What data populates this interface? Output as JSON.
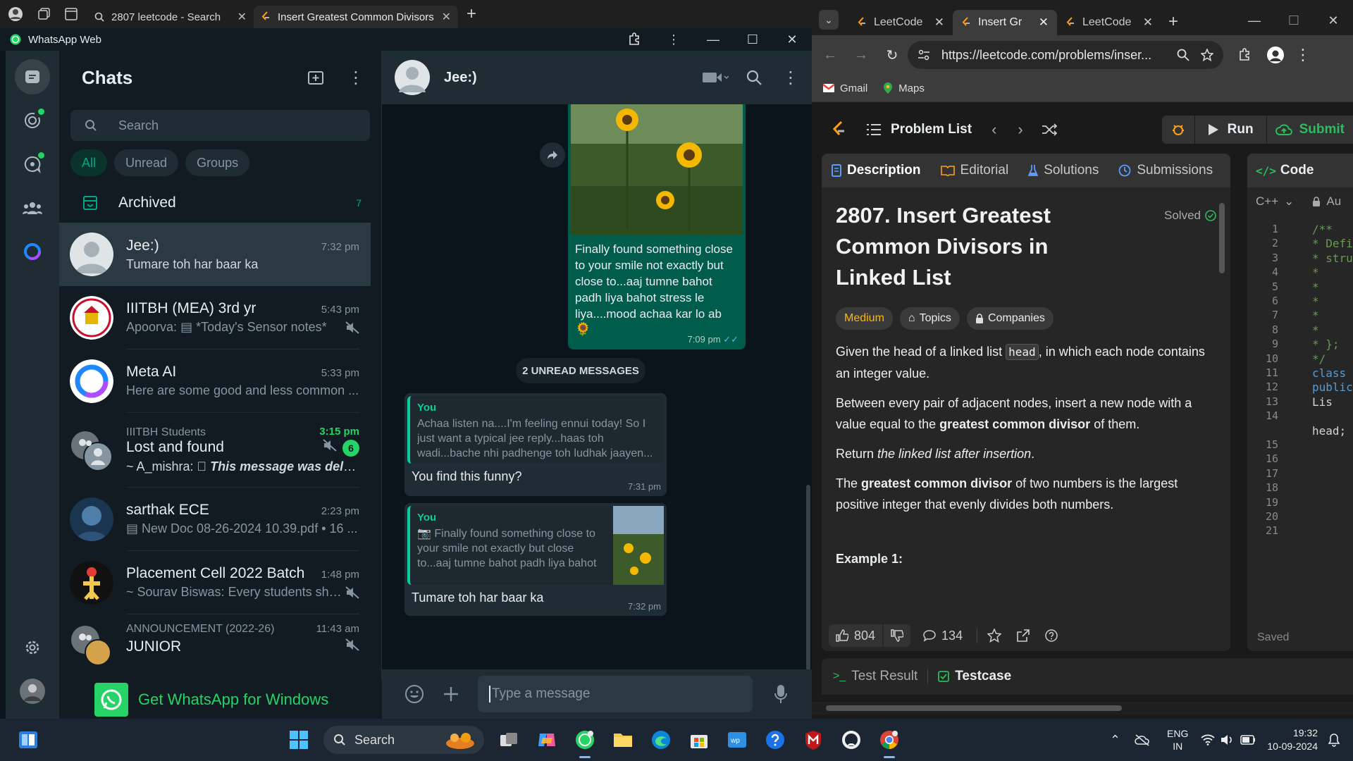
{
  "left_browser": {
    "tabs": [
      {
        "title": "2807 leetcode - Search"
      },
      {
        "title": "Insert Greatest Common Divisors"
      }
    ],
    "app_title": "WhatsApp Web"
  },
  "chats_panel": {
    "title": "Chats",
    "search_placeholder": "Search",
    "filters": [
      "All",
      "Unread",
      "Groups"
    ],
    "archived": {
      "label": "Archived",
      "count": "7"
    },
    "items": [
      {
        "name": "Jee:)",
        "time": "7:32 pm",
        "preview": "Tumare toh har baar ka"
      },
      {
        "name": "IIITBH (MEA)  3rd yr",
        "time": "5:43 pm",
        "sender": "Apoorva:",
        "preview": "*Today's Sensor notes*"
      },
      {
        "name": "Meta AI",
        "time": "5:33 pm",
        "preview": "Here are some good and less common ..."
      },
      {
        "group_label": "IIITBH Students",
        "name": "Lost and found",
        "time": "3:15 pm",
        "unread": "6",
        "sender": "~ A_mishra:",
        "preview": "This message was deleted"
      },
      {
        "name": "sarthak ECE",
        "time": "2:23 pm",
        "preview": "New Doc 08-26-2024 10.39.pdf • 16 ..."
      },
      {
        "name": "Placement Cell 2022 Batch",
        "time": "1:48 pm",
        "preview": "~ Sourav Biswas: Every students shou..."
      },
      {
        "group_label": "ANNOUNCEMENT (2022-26)",
        "name": "JUNIOR",
        "time": "11:43 am"
      }
    ],
    "get_app": "Get WhatsApp for Windows"
  },
  "conversation": {
    "contact": "Jee:)",
    "messages": [
      {
        "type": "out_image",
        "text": "Finally found something close to your smile not exactly but close to...aaj tumne bahot padh liya bahot stress le liya....mood achaa kar lo ab",
        "emoji": "🌻",
        "time": "7:09 pm"
      },
      {
        "type": "divider",
        "text": "2 UNREAD MESSAGES"
      },
      {
        "type": "in_reply",
        "quote_author": "You",
        "quote_text": "Achaa listen na....I'm feeling ennui today! So I just want a typical jee reply...haas toh wadi...bache nhi padhenge toh ludhak jaayen...",
        "text": "You find this funny?",
        "time": "7:31 pm"
      },
      {
        "type": "in_reply",
        "quote_author": "You",
        "quote_text": "Finally found something close to your smile not exactly but close to...aaj tumne bahot padh liya bahot stress le liya....mood achaa kar lo ab...",
        "text": "Tumare toh har baar ka",
        "time": "7:32 pm"
      }
    ],
    "composer_placeholder": "Type a message"
  },
  "right_browser": {
    "tabs": [
      {
        "title": "LeetCode"
      },
      {
        "title": "Insert Gr"
      },
      {
        "title": "LeetCode"
      }
    ],
    "url": "https://leetcode.com/problems/inser...",
    "bookmarks": [
      "Gmail",
      "Maps"
    ],
    "nav": {
      "problem_list": "Problem List",
      "run": "Run",
      "submit": "Submit"
    },
    "desc_tabs": [
      "Description",
      "Editorial",
      "Solutions",
      "Submissions"
    ],
    "problem": {
      "title": "2807. Insert Greatest Common Divisors in Linked List",
      "status": "Solved",
      "difficulty": "Medium",
      "tags": [
        "Topics",
        "Companies"
      ],
      "p1_a": "Given the head of a linked list ",
      "p1_code": "head",
      "p1_b": ", in which each node contains an integer value.",
      "p2_a": "Between every pair of adjacent nodes, insert a new node with a value equal to the ",
      "p2_bold": "greatest common divisor",
      "p2_b": " of them.",
      "p3_a": "Return ",
      "p3_em": "the linked list after insertion",
      "p3_b": ".",
      "p4_a": "The ",
      "p4_bold": "greatest common divisor",
      "p4_b": " of two numbers is the largest positive integer that evenly divides both numbers.",
      "example": "Example 1:",
      "likes": "804",
      "comments": "134"
    },
    "code_panel": {
      "title": "Code",
      "lang": "C++",
      "auto": "Au",
      "saved": "Saved",
      "line_numbers": [
        "1",
        "2",
        "3",
        "4",
        "5",
        "6",
        "7",
        "8",
        "9",
        "10",
        "11",
        "12",
        "13",
        "14",
        "",
        "15",
        "16",
        "17",
        "18",
        "19",
        "20",
        "21"
      ],
      "lines": [
        "/**",
        " * Defi",
        " * stru",
        " *",
        " *",
        " *",
        " *",
        " *",
        " * };",
        " */",
        "class S",
        "public:",
        "    Lis",
        "",
        "head;",
        "",
        "",
        "",
        "",
        "",
        "",
        ""
      ]
    },
    "test_tabs": [
      "Test Result",
      "Testcase"
    ]
  },
  "taskbar": {
    "search": "Search",
    "lang_top": "ENG",
    "lang_bottom": "IN",
    "time": "19:32",
    "date": "10-09-2024"
  },
  "colors": {
    "wa_green": "#25d366",
    "wa_bubble_out": "#005c4b",
    "lc_orange": "#ffa116",
    "lc_green": "#2cbb5d"
  }
}
